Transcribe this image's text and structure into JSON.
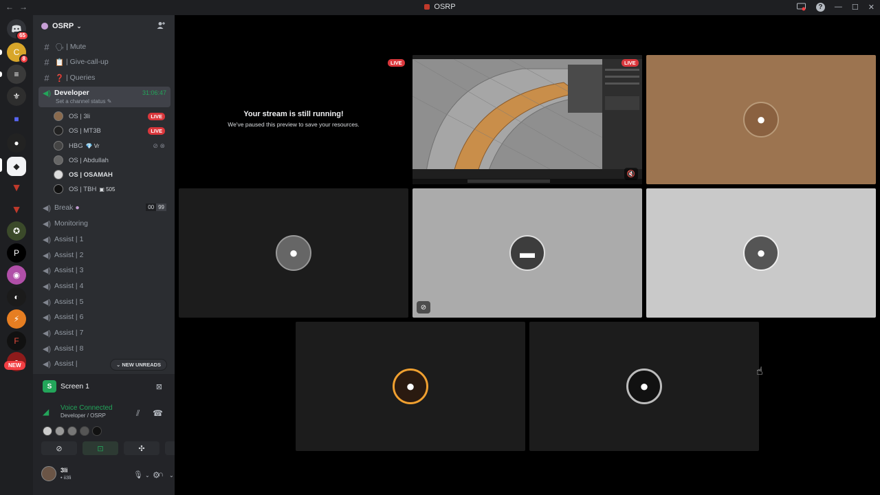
{
  "titlebar": {
    "back": "←",
    "forward": "→",
    "title": "OSRP",
    "help": "?",
    "minimize": "—",
    "maximize": "☐",
    "close": "✕"
  },
  "guilds": {
    "home_badge": "65",
    "badge_2": "8",
    "new_label": "NEW"
  },
  "server": {
    "name": "OSRP",
    "channels": [
      {
        "emoji": "🗣",
        "name": "| Mute"
      },
      {
        "emoji": "📋",
        "name": "| Give-call-up"
      },
      {
        "emoji": "❓",
        "name": "| Queries"
      }
    ],
    "active_voice": {
      "name": "Developer",
      "timer": "31:06:47",
      "status_placeholder": "Set a channel status"
    },
    "voice_users": [
      {
        "name": "OS | 3li",
        "live": "LIVE"
      },
      {
        "name": "OS | MT3B",
        "live": "LIVE"
      },
      {
        "name": "HBG",
        "tag": "💎 Vr"
      },
      {
        "name": "OS | Abdullah"
      },
      {
        "name": "OS | OSAMAH"
      },
      {
        "name": "OS | TBH",
        "tag": "505"
      }
    ],
    "break_channel": {
      "name": "Break",
      "count_a": "00",
      "count_b": "99"
    },
    "voice_channels": [
      "Monitoring",
      "Assist | 1",
      "Assist | 2",
      "Assist | 3",
      "Assist | 4",
      "Assist | 5",
      "Assist | 6",
      "Assist | 7",
      "Assist | 8",
      "Assist |"
    ],
    "new_unreads": "NEW UNREADS"
  },
  "panel": {
    "screen_label": "Screen 1",
    "voice_connected": "Voice Connected",
    "voice_location": "Developer / OSRP",
    "user_name": "3li",
    "user_status": "• ii3li"
  },
  "stage": {
    "live_label": "LIVE",
    "paused_title": "Your stream is still running!",
    "paused_text": "We've paused this preview to save your resources."
  },
  "colors": {
    "accent_green": "#23a55a",
    "live_red": "#da373c",
    "sidebar_bg": "#2b2d31",
    "panel_bg": "#232428"
  }
}
